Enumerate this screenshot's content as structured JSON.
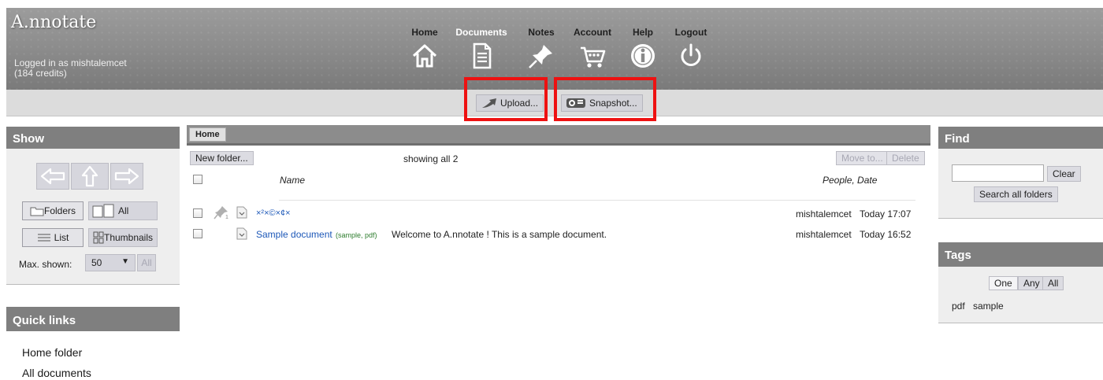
{
  "header": {
    "logo": "A.nnotate",
    "login_line1": "Logged in as mishtalemcet",
    "login_line2": "(184 credits)",
    "nav": [
      {
        "label": "Home",
        "icon": "home-icon"
      },
      {
        "label": "Documents",
        "icon": "document-icon",
        "active": true
      },
      {
        "label": "Notes",
        "icon": "pin-icon"
      },
      {
        "label": "Account",
        "icon": "cart-icon"
      },
      {
        "label": "Help",
        "icon": "info-icon"
      },
      {
        "label": "Logout",
        "icon": "power-icon"
      }
    ]
  },
  "toolbar": {
    "upload_label": "Upload...",
    "snapshot_label": "Snapshot..."
  },
  "show_panel": {
    "title": "Show",
    "folders_label": "Folders",
    "all_label": "All",
    "list_label": "List",
    "thumbnails_label": "Thumbnails",
    "max_shown_label": "Max. shown:",
    "max_shown_value": "50",
    "all_button": "All"
  },
  "quick_links": {
    "title": "Quick links",
    "items": [
      "Home folder",
      "All documents"
    ]
  },
  "main": {
    "breadcrumb": "Home",
    "new_folder": "New folder...",
    "showing": "showing all 2",
    "move_to": "Move to...",
    "delete": "Delete",
    "col_name": "Name",
    "col_people_date": "People,  Date",
    "rows": [
      {
        "name": "×²×©×¢×",
        "tags": "",
        "description": "",
        "people": "mishtalemcet",
        "date": "Today 17:07",
        "pinned": true
      },
      {
        "name": "Sample document",
        "tags": "(sample, pdf)",
        "description": "Welcome to A.nnotate ! This is a sample document.",
        "people": "mishtalemcet",
        "date": "Today 16:52",
        "pinned": false
      }
    ]
  },
  "find_panel": {
    "title": "Find",
    "search_value": "",
    "clear": "Clear",
    "search_all": "Search all folders"
  },
  "tags_panel": {
    "title": "Tags",
    "modes": [
      "One",
      "Any",
      "All"
    ],
    "active_mode": "One",
    "tags": [
      "pdf",
      "sample"
    ]
  },
  "colors": {
    "header_gray": "#8a8a8a",
    "highlight_red": "#ee1111",
    "link_blue": "#1d58b8",
    "panel_head": "#7f7f7f"
  }
}
